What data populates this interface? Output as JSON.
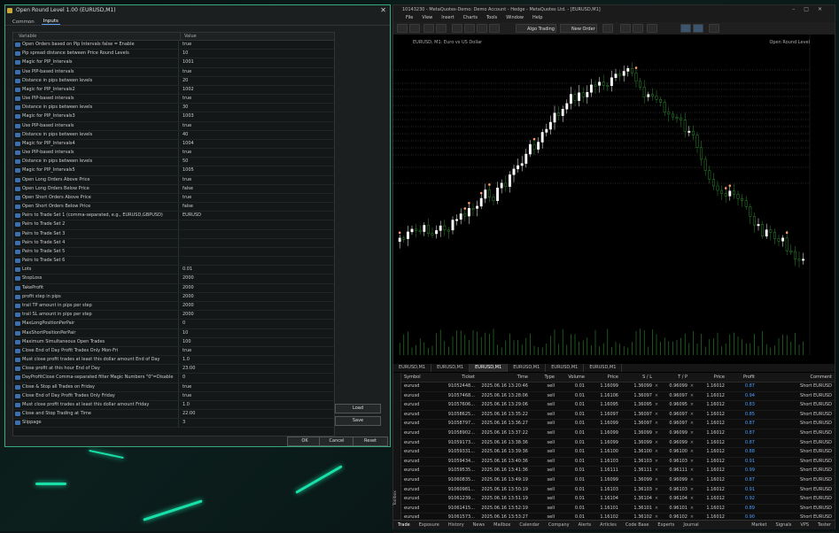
{
  "dialog": {
    "title": "Open Round Level 1.00 (EURUSD,M1)",
    "tabs": [
      "Common",
      "Inputs"
    ],
    "active_tab": "Inputs",
    "col_variable": "Variable",
    "col_value": "Value",
    "params": [
      {
        "name": "Open Orders based on Pip Intervals false = Enable",
        "value": "true"
      },
      {
        "name": "Pip spread distance between Price Round Levels",
        "value": "10"
      },
      {
        "name": "Magic for PIP_Intervals",
        "value": "1001"
      },
      {
        "name": "Use PIP-based intervals",
        "value": "true"
      },
      {
        "name": "Distance in pips between levels",
        "value": "20"
      },
      {
        "name": "Magic for PIP_Intervals2",
        "value": "1002"
      },
      {
        "name": "Use PIP-based intervals",
        "value": "true"
      },
      {
        "name": "Distance in pips between levels",
        "value": "30"
      },
      {
        "name": "Magic for PIP_Intervals3",
        "value": "1003"
      },
      {
        "name": "Use PIP-based intervals",
        "value": "true"
      },
      {
        "name": "Distance in pips between levels",
        "value": "40"
      },
      {
        "name": "Magic for PIP_Intervals4",
        "value": "1004"
      },
      {
        "name": "Use PIP-based intervals",
        "value": "true"
      },
      {
        "name": "Distance in pips between levels",
        "value": "50"
      },
      {
        "name": "Magic for PIP_Intervals5",
        "value": "1005"
      },
      {
        "name": "Open Long Orders Above Price",
        "value": "true"
      },
      {
        "name": "Open Long Orders Below Price",
        "value": "false"
      },
      {
        "name": "Open Short Orders Above Price",
        "value": "true"
      },
      {
        "name": "Open Short Orders Below Price",
        "value": "false"
      },
      {
        "name": "Pairs to Trade Set 1 (comma-separated, e.g., EURUSD,GBPUSD)",
        "value": "EURUSD"
      },
      {
        "name": "Pairs to Trade Set 2",
        "value": ""
      },
      {
        "name": "Pairs to Trade Set 3",
        "value": ""
      },
      {
        "name": "Pairs to Trade Set 4",
        "value": ""
      },
      {
        "name": "Pairs to Trade Set 5",
        "value": ""
      },
      {
        "name": "Pairs to Trade Set 6",
        "value": ""
      },
      {
        "name": "Lots",
        "value": "0.01"
      },
      {
        "name": "StopLoss",
        "value": "2000"
      },
      {
        "name": "TakeProfit",
        "value": "2000"
      },
      {
        "name": "profit step in pips",
        "value": "2000"
      },
      {
        "name": "trail TP amount in pips per step",
        "value": "2000"
      },
      {
        "name": "trail SL amount in pips per step",
        "value": "2000"
      },
      {
        "name": "MaxLongPositionPerPair",
        "value": "0"
      },
      {
        "name": "MaxShortPositionPerPair",
        "value": "10"
      },
      {
        "name": "Maximum Simultaneous Open Trades",
        "value": "100"
      },
      {
        "name": "Close End of Day Profit Trades Only Mon-Fri",
        "value": "true"
      },
      {
        "name": "Must close profit trades at least this dollar amount End of Day",
        "value": "1.0"
      },
      {
        "name": "Close profit at this hour End of Day",
        "value": "23:00"
      },
      {
        "name": "DayProfitClose Comma-separated filter Magic Numbers \"0\"=Disable",
        "value": "0"
      },
      {
        "name": "Close & Stop all Trades on Friday",
        "value": "true"
      },
      {
        "name": "Close End of Day Profit Trades Only Friday",
        "value": "true"
      },
      {
        "name": "Must close profit trades at least this dollar amount Friday",
        "value": "1.0"
      },
      {
        "name": "Close and Stop Trading at Time",
        "value": "22:00"
      },
      {
        "name": "Slippage",
        "value": "3"
      }
    ],
    "load_label": "Load",
    "save_label": "Save",
    "ok_label": "OK",
    "cancel_label": "Cancel",
    "reset_label": "Reset"
  },
  "terminal": {
    "title": "10143230 - MetaQuotes-Demo: Demo Account - Hedge - MetaQuotes Ltd. - [EURUSD,M1]",
    "menu": [
      "File",
      "View",
      "Insert",
      "Charts",
      "Tools",
      "Window",
      "Help"
    ],
    "algo_label": "Algo Trading",
    "new_order_label": "New Order",
    "chart_header": "EURUSD, M1: Euro vs US Dollar",
    "ea_label": "Open Round Level",
    "chart_tabs": [
      "EURUSD,M1",
      "EURUSD,M1",
      "EURUSD,M1",
      "EURUSD,M1",
      "EURUSD,M1",
      "EURUSD,M1"
    ],
    "trade_columns": [
      "Symbol",
      "Ticket",
      "Time",
      "Type",
      "Volume",
      "Price",
      "S / L",
      "T / P",
      "Price",
      "Profit",
      "Comment"
    ],
    "positions": [
      {
        "symbol": "eurusd",
        "ticket": "91052448...",
        "time": "2025.06.16 13:20:46",
        "type": "sell",
        "volume": "0.01",
        "price": "1.16099",
        "sl": "1.36099",
        "tp": "0.96099",
        "cur": "1.16012",
        "profit": "0.87",
        "comment": "Short EURUSD"
      },
      {
        "symbol": "eurusd",
        "ticket": "91057468...",
        "time": "2025.06.16 13:28:06",
        "type": "sell",
        "volume": "0.01",
        "price": "1.16106",
        "sl": "1.36097",
        "tp": "0.96097",
        "cur": "1.16012",
        "profit": "0.94",
        "comment": "Short EURUSD"
      },
      {
        "symbol": "eurusd",
        "ticket": "91057606...",
        "time": "2025.06.16 13:29:06",
        "type": "sell",
        "volume": "0.01",
        "price": "1.16095",
        "sl": "1.36095",
        "tp": "0.96095",
        "cur": "1.16012",
        "profit": "0.83",
        "comment": "Short EURUSD"
      },
      {
        "symbol": "eurusd",
        "ticket": "91058625...",
        "time": "2025.06.16 13:35:22",
        "type": "sell",
        "volume": "0.01",
        "price": "1.16097",
        "sl": "1.36097",
        "tp": "0.96097",
        "cur": "1.16012",
        "profit": "0.85",
        "comment": "Short EURUSD"
      },
      {
        "symbol": "eurusd",
        "ticket": "91058797...",
        "time": "2025.06.16 13:36:27",
        "type": "sell",
        "volume": "0.01",
        "price": "1.16099",
        "sl": "1.36097",
        "tp": "0.96097",
        "cur": "1.16012",
        "profit": "0.87",
        "comment": "Short EURUSD"
      },
      {
        "symbol": "eurusd",
        "ticket": "91058902...",
        "time": "2025.06.16 13:37:22",
        "type": "sell",
        "volume": "0.01",
        "price": "1.16099",
        "sl": "1.36099",
        "tp": "0.96099",
        "cur": "1.16012",
        "profit": "0.87",
        "comment": "Short EURUSD"
      },
      {
        "symbol": "eurusd",
        "ticket": "91059173...",
        "time": "2025.06.16 13:38:36",
        "type": "sell",
        "volume": "0.01",
        "price": "1.16099",
        "sl": "1.36099",
        "tp": "0.96099",
        "cur": "1.16012",
        "profit": "0.87",
        "comment": "Short EURUSD"
      },
      {
        "symbol": "eurusd",
        "ticket": "91059331...",
        "time": "2025.06.16 13:39:36",
        "type": "sell",
        "volume": "0.01",
        "price": "1.16100",
        "sl": "1.36100",
        "tp": "0.96100",
        "cur": "1.16012",
        "profit": "0.88",
        "comment": "Short EURUSD"
      },
      {
        "symbol": "eurusd",
        "ticket": "91059434...",
        "time": "2025.06.16 13:40:36",
        "type": "sell",
        "volume": "0.01",
        "price": "1.16103",
        "sl": "1.36103",
        "tp": "0.96103",
        "cur": "1.16012",
        "profit": "0.91",
        "comment": "Short EURUSD"
      },
      {
        "symbol": "eurusd",
        "ticket": "91059535...",
        "time": "2025.06.16 13:41:36",
        "type": "sell",
        "volume": "0.01",
        "price": "1.16111",
        "sl": "1.36111",
        "tp": "0.96111",
        "cur": "1.16012",
        "profit": "0.99",
        "comment": "Short EURUSD"
      },
      {
        "symbol": "eurusd",
        "ticket": "91060835...",
        "time": "2025.06.16 13:49:19",
        "type": "sell",
        "volume": "0.01",
        "price": "1.16099",
        "sl": "1.36099",
        "tp": "0.96099",
        "cur": "1.16012",
        "profit": "0.87",
        "comment": "Short EURUSD"
      },
      {
        "symbol": "eurusd",
        "ticket": "91060981...",
        "time": "2025.06.16 13:50:19",
        "type": "sell",
        "volume": "0.01",
        "price": "1.16103",
        "sl": "1.36103",
        "tp": "0.96103",
        "cur": "1.16012",
        "profit": "0.91",
        "comment": "Short EURUSD"
      },
      {
        "symbol": "eurusd",
        "ticket": "91061239...",
        "time": "2025.06.16 13:51:19",
        "type": "sell",
        "volume": "0.01",
        "price": "1.16104",
        "sl": "1.36104",
        "tp": "0.96104",
        "cur": "1.16012",
        "profit": "0.92",
        "comment": "Short EURUSD"
      },
      {
        "symbol": "eurusd",
        "ticket": "91061415...",
        "time": "2025.06.16 13:52:19",
        "type": "sell",
        "volume": "0.01",
        "price": "1.16101",
        "sl": "1.36101",
        "tp": "0.96101",
        "cur": "1.16012",
        "profit": "0.89",
        "comment": "Short EURUSD"
      },
      {
        "symbol": "eurusd",
        "ticket": "91061573...",
        "time": "2025.06.16 13:53:27",
        "type": "sell",
        "volume": "0.01",
        "price": "1.16102",
        "sl": "1.36102",
        "tp": "0.96102",
        "cur": "1.16012",
        "profit": "0.90",
        "comment": "Short EURUSD"
      },
      {
        "symbol": "eurusd",
        "ticket": "91061768...",
        "time": "2025.06.16 13:55:03",
        "type": "sell",
        "volume": "0.01",
        "price": "1.16099",
        "sl": "1.36099",
        "tp": "0.96099",
        "cur": "1.16012",
        "profit": "0.87",
        "comment": "Short EURUSD"
      }
    ],
    "bottom_tabs": [
      "Trade",
      "Exposure",
      "History",
      "News",
      "Mailbox",
      "Calendar",
      "Company",
      "Alerts",
      "Articles",
      "Code Base",
      "Experts",
      "Journal"
    ],
    "side_label": "Toolbox",
    "market_label": "Market",
    "signals_label": "Signals",
    "vps_label": "VPS",
    "tester_label": "Tester"
  },
  "colors": {
    "accent": "#19e0a8",
    "bull": "#ffffff",
    "bear": "#2e8b2e",
    "profit": "#4a9fff"
  }
}
